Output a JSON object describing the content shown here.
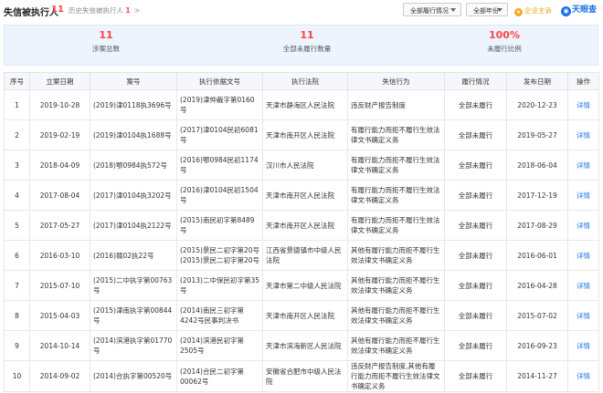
{
  "header": {
    "title": "失信被执行人",
    "count": "11",
    "history_label": "历史失信被执行人",
    "history_count": "1",
    "history_arrow": ">",
    "filter_status": "全部履行情况",
    "filter_year": "全部年份",
    "enterprise_label": "企业主诉",
    "logo_text": "天眼查"
  },
  "stats": [
    {
      "value": "11",
      "label": "涉案总数"
    },
    {
      "value": "11",
      "label": "全部未履行数量"
    },
    {
      "value": "100%",
      "label": "未履行比例"
    }
  ],
  "table": {
    "columns": [
      "序号",
      "立案日期",
      "案号",
      "执行依据文号",
      "执行法院",
      "失信行为",
      "履行情况",
      "发布日期",
      "操作"
    ],
    "rows": [
      {
        "no": "1",
        "date": "2019-10-28",
        "case": "(2019)津0118执3696号",
        "basis": "(2019)津仲裁字第0160号",
        "court": "天津市静海区人民法院",
        "behavior": "违反财产报告制度",
        "status": "全部未履行",
        "publish": "2020-12-23",
        "action": "详情"
      },
      {
        "no": "2",
        "date": "2019-02-19",
        "case": "(2019)津0104执1688号",
        "basis": "(2017)津0104民初6081号",
        "court": "天津市南开区人民法院",
        "behavior": "有履行能力而拒不履行生效法律文书确定义务",
        "status": "全部未履行",
        "publish": "2019-05-27",
        "action": "详情"
      },
      {
        "no": "3",
        "date": "2018-04-09",
        "case": "(2018)鄂0984执572号",
        "basis": "(2016)鄂0984民初1174号",
        "court": "汉川市人民法院",
        "behavior": "有履行能力而拒不履行生效法律文书确定义务",
        "status": "全部未履行",
        "publish": "2018-06-04",
        "action": "详情"
      },
      {
        "no": "4",
        "date": "2017-08-04",
        "case": "(2017)津0104执3202号",
        "basis": "(2016)津0104民初1504号",
        "court": "天津市南开区人民法院",
        "behavior": "有履行能力而拒不履行生效法律文书确定义务",
        "status": "全部未履行",
        "publish": "2017-12-19",
        "action": "详情"
      },
      {
        "no": "5",
        "date": "2017-05-27",
        "case": "(2017)津0104执2122号",
        "basis": "(2015)南民初字第8489号",
        "court": "天津市南开区人民法院",
        "behavior": "有履行能力而拒不履行生效法律文书确定义务",
        "status": "全部未履行",
        "publish": "2017-08-29",
        "action": "详情"
      },
      {
        "no": "6",
        "date": "2016-03-10",
        "case": "(2016)赣02执22号",
        "basis": "(2015)景民二初字第20号\n(2015)景民二初字第20号",
        "court": "江西省景德镇市中级人民法院",
        "behavior": "其他有履行能力而拒不履行生效法律文书确定义务",
        "status": "全部未履行",
        "publish": "2016-06-01",
        "action": "详情"
      },
      {
        "no": "7",
        "date": "2015-07-10",
        "case": "(2015)二中执字第00763号",
        "basis": "(2013)二中保民初字第35号",
        "court": "天津市第二中级人民法院",
        "behavior": "其他有履行能力而拒不履行生效法律文书确定义务",
        "status": "全部未履行",
        "publish": "2016-04-28",
        "action": "详情"
      },
      {
        "no": "8",
        "date": "2015-04-03",
        "case": "(2015)津南执字第00844号",
        "basis": "(2014)南民三初字第4242号民事判决书",
        "court": "天津市南开区人民法院",
        "behavior": "其他有履行能力而拒不履行生效法律文书确定义务",
        "status": "全部未履行",
        "publish": "2015-07-02",
        "action": "详情"
      },
      {
        "no": "9",
        "date": "2014-10-14",
        "case": "(2014)滨港执字第01770号",
        "basis": "(2014)滨港民初字第2505号",
        "court": "天津市滨海新区人民法院",
        "behavior": "其他有履行能力而拒不履行生效法律文书确定义务",
        "status": "全部未履行",
        "publish": "2016-09-23",
        "action": "详情"
      },
      {
        "no": "10",
        "date": "2014-09-02",
        "case": "(2014)合执字第00520号",
        "basis": "(2014)合民二初字第00062号",
        "court": "安徽省合肥市中级人民法院",
        "behavior": "违反财产报告制度,其他有履行能力而拒不履行生效法律文书确定义务",
        "status": "全部未履行",
        "publish": "2014-11-27",
        "action": "详情"
      }
    ]
  }
}
